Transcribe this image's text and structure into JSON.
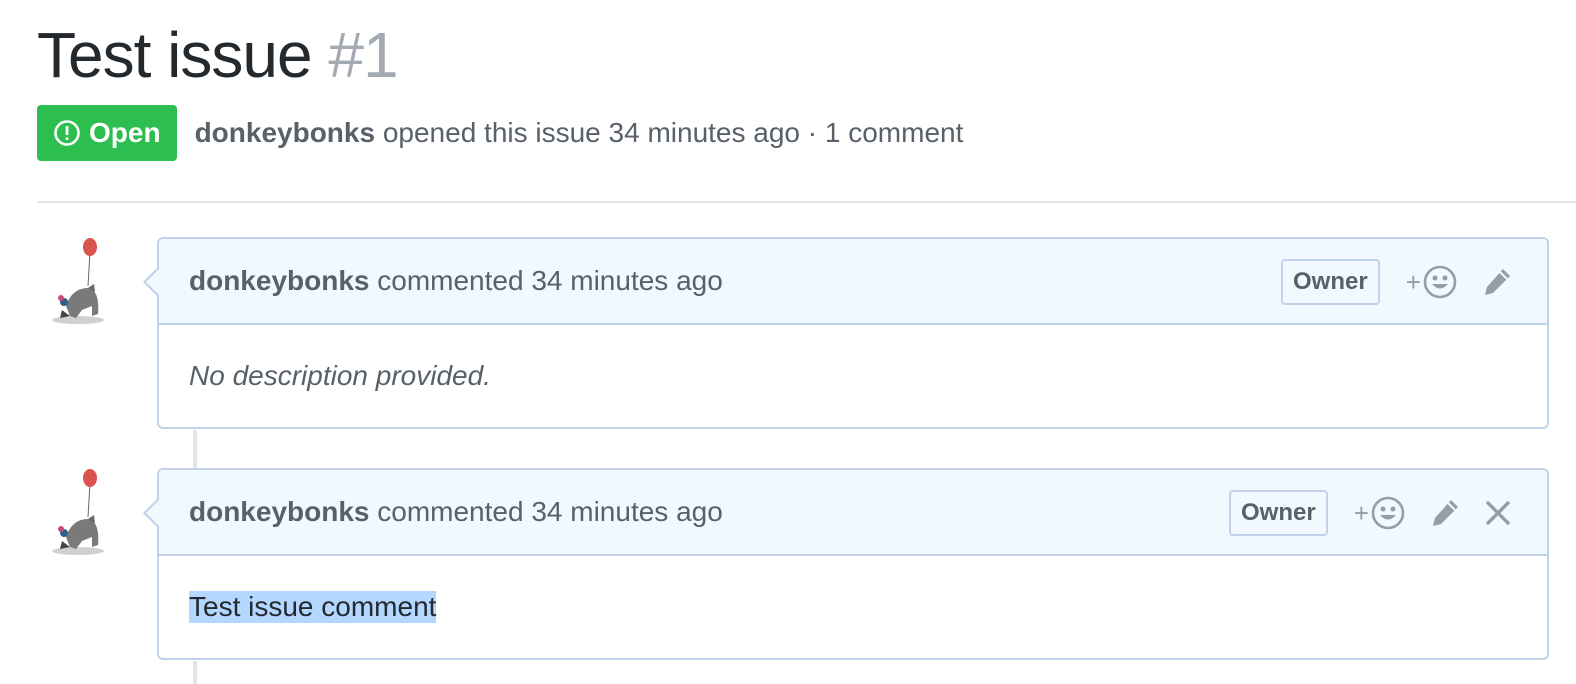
{
  "issue": {
    "title": "Test issue",
    "number": "#1",
    "state": "Open",
    "state_color": "#2cbe4e",
    "author": "donkeybonks",
    "meta_text": "opened this issue 34 minutes ago · 1 comment"
  },
  "comments": [
    {
      "author": "donkeybonks",
      "action_text": "commented 34 minutes ago",
      "badge": "Owner",
      "reaction_plus": "+",
      "body": "No description provided.",
      "icons": [
        "add-reaction-icon",
        "pencil-icon"
      ]
    },
    {
      "author": "donkeybonks",
      "action_text": "commented 34 minutes ago",
      "badge": "Owner",
      "reaction_plus": "+",
      "body": "Test issue comment",
      "icons": [
        "add-reaction-icon",
        "pencil-icon",
        "close-icon"
      ]
    }
  ],
  "colors": {
    "header_bg": "#f1f8ff",
    "border": "#c0d3eb",
    "selection": "#b3d7ff"
  }
}
